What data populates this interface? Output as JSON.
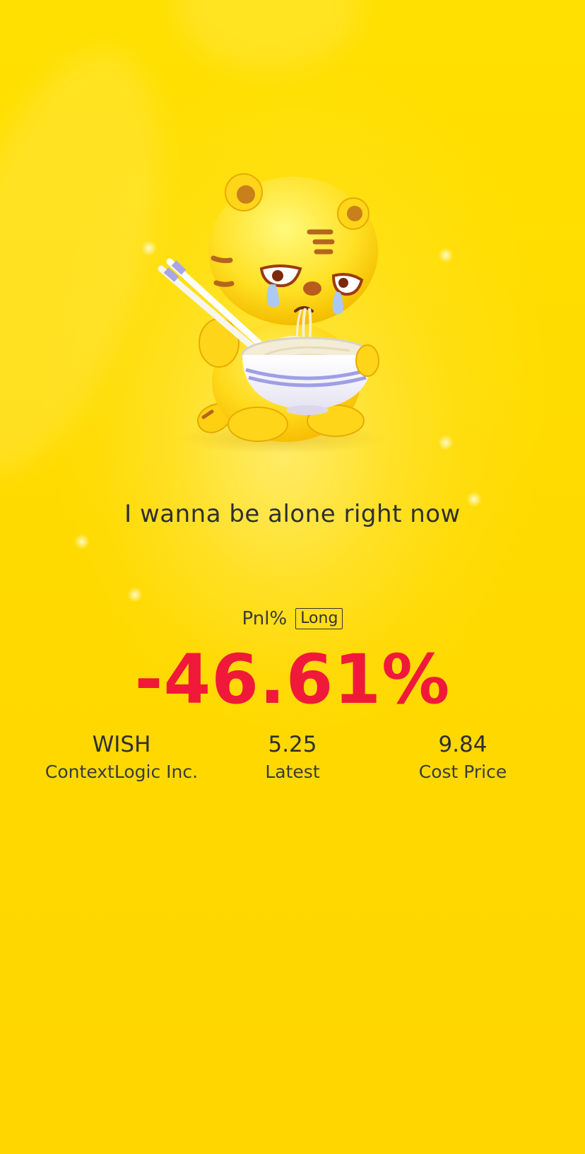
{
  "caption": "I wanna be alone right now",
  "pnl": {
    "label": "Pnl%",
    "badge": "Long",
    "value": "-46.61%"
  },
  "stats": [
    {
      "value": "WISH",
      "label": "ContextLogic Inc."
    },
    {
      "value": "5.25",
      "label": "Latest"
    },
    {
      "value": "9.84",
      "label": "Cost Price"
    }
  ],
  "colors": {
    "background": "#ffdc00",
    "loss": "#f0193a",
    "text": "#2f2f2f"
  },
  "icons": {
    "mascot": "crying-tiger-eating-noodles-illustration"
  }
}
